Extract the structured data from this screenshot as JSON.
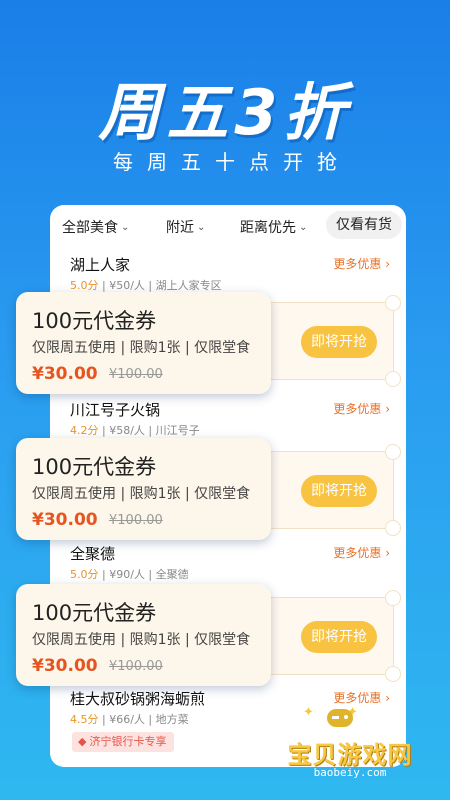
{
  "hero": {
    "title": "周五3折",
    "subtitle": "每周五十点开抢"
  },
  "filters": [
    {
      "label": "全部美食"
    },
    {
      "label": "附近"
    },
    {
      "label": "距离优先"
    }
  ],
  "stock_filter": "仅看有货",
  "shops": [
    {
      "name": "湖上人家",
      "more": "更多优惠",
      "rating": "5.0分",
      "meta": "| ¥50/人 | 湖上人家专区"
    },
    {
      "name": "川江号子火锅",
      "more": "更多优惠",
      "rating": "4.2分",
      "meta": "| ¥58/人 | 川江号子"
    },
    {
      "name": "全聚德",
      "more": "更多优惠",
      "rating": "5.0分",
      "meta": "| ¥90/人 | 全聚德"
    },
    {
      "name": "桂大叔砂锅粥海蛎煎",
      "more": "更多优惠",
      "rating": "4.5分",
      "meta": "| ¥66/人 | 地方菜"
    }
  ],
  "coupons": [
    {
      "title": "100元代金券",
      "rules": "仅限周五使用 | 限购1张 | 仅限堂食",
      "price": "¥30.00",
      "original": "¥100.00",
      "button": "即将开抢"
    },
    {
      "title": "100元代金券",
      "rules": "仅限周五使用 | 限购1张 | 仅限堂食",
      "price": "¥30.00",
      "original": "¥100.00",
      "button": "即将开抢"
    },
    {
      "title": "100元代金券",
      "rules": "仅限周五使用 | 限购1张 | 仅限堂食",
      "price": "¥30.00",
      "original": "¥100.00",
      "button": "即将开抢"
    }
  ],
  "bank_tag": "济宁银行卡专享",
  "watermark": {
    "text": "宝贝游戏网",
    "url": "baobeiy.com"
  },
  "icons": {
    "chevron": "chevron-down-icon",
    "arrow": "chevron-right-icon",
    "gamepad": "gamepad-icon"
  },
  "colors": {
    "background": "#1a7fe8",
    "accent_orange": "#e8712a",
    "price_red": "#e8541f",
    "button_yellow": "#f7c341"
  }
}
